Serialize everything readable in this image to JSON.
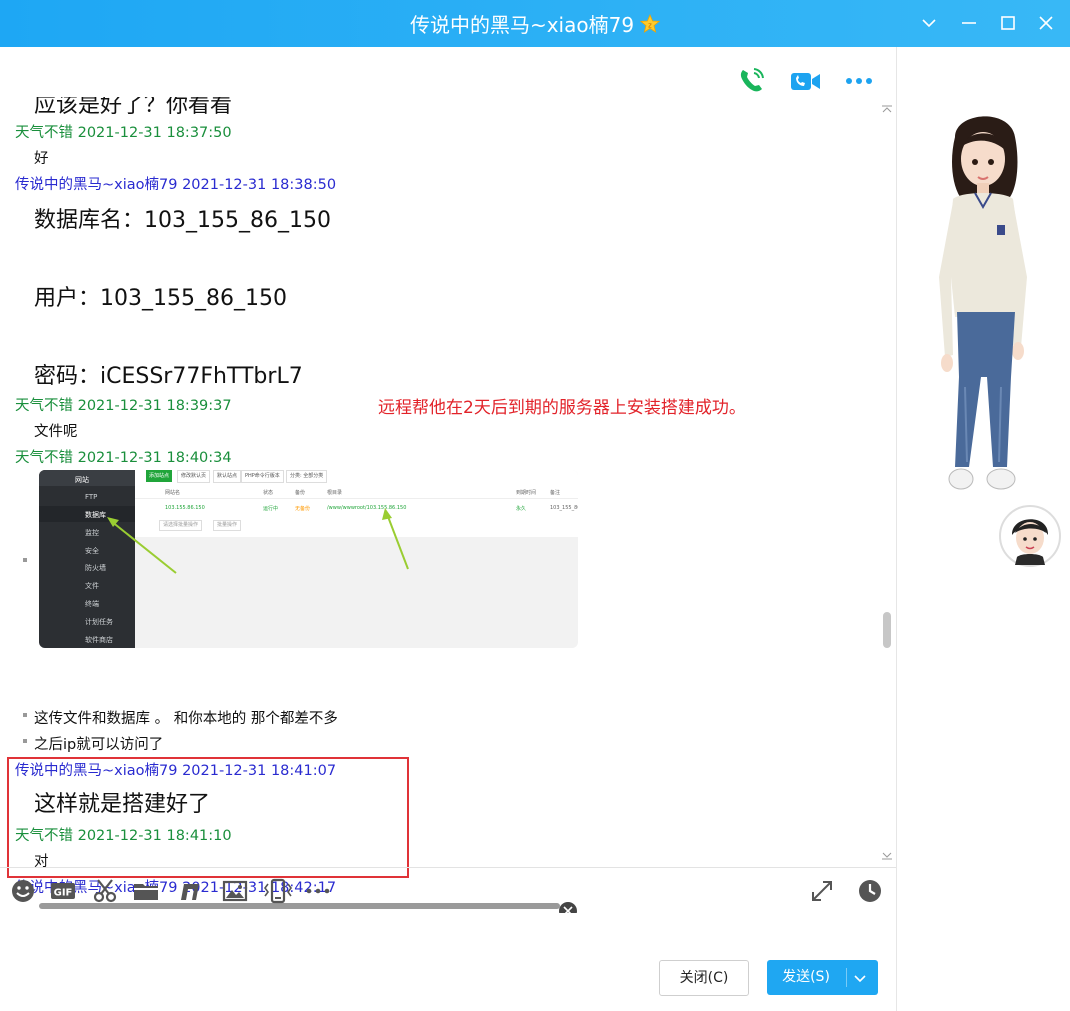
{
  "window": {
    "title": "传说中的黑马~xiao楠79"
  },
  "colors": {
    "titlebar": "#1ea7f4",
    "self_name": "#2a2bd0",
    "peer_name": "#1a8f3c",
    "highlight": "#e03338",
    "send_button": "#1fa7f2"
  },
  "chat": {
    "partial_top": "应该是好了？你看看",
    "messages": [
      {
        "header": "天气不错 2021-12-31 18:37:50",
        "text": "好"
      },
      {
        "header": "传说中的黑马~xiao楠79 2021-12-31 18:38:50",
        "lines": [
          "数据库名：103_155_86_150",
          "用户：103_155_86_150",
          "密码：iCESSr77FhTTbrL7"
        ]
      },
      {
        "header": "天气不错 2021-12-31 18:39:37",
        "text": "文件呢"
      },
      {
        "header": "天气不错 2021-12-31 18:40:34",
        "image": "server-panel-screenshot",
        "bullets": [
          "这传文件和数据库 。 和你本地的 那个都差不多",
          "之后ip就可以访问了"
        ]
      },
      {
        "header": "传说中的黑马~xiao楠79 2021-12-31 18:41:07",
        "text": "这样就是搭建好了"
      },
      {
        "header": "天气不错 2021-12-31 18:41:10",
        "text": "对"
      },
      {
        "header": "传说中的黑马~xiao楠79 2021-12-31 18:42:17"
      }
    ],
    "annotation": "远程帮他在2天后到期的服务器上安装搭建成功。"
  },
  "screenshot": {
    "menu": [
      "网站",
      "FTP",
      "数据库",
      "监控",
      "安全",
      "防火墙",
      "文件",
      "终端",
      "计划任务",
      "软件商店"
    ],
    "buttons": [
      "添加站点",
      "修改默认页",
      "默认站点",
      "PHP命令行版本",
      "分类: 全部分类"
    ],
    "columns": [
      "网站名",
      "状态",
      "备份",
      "根目录",
      "到期时间",
      "备注"
    ],
    "row": [
      "103.155.86.150",
      "运行中",
      "无备份",
      "/www/wwwroot/103.155.86.150",
      "永久",
      "103_155_86_1"
    ],
    "footer": [
      "请选择批量操作",
      "批量操作"
    ]
  },
  "toolbar": {
    "icons": [
      "emoji-icon",
      "gif-icon",
      "scissors-icon",
      "folder-icon",
      "music-icon",
      "image-icon",
      "shake-icon",
      "more-icon"
    ],
    "right_icons": [
      "expand-icon",
      "history-icon"
    ]
  },
  "buttons": {
    "close": "关闭(C)",
    "send": "发送(S)"
  }
}
